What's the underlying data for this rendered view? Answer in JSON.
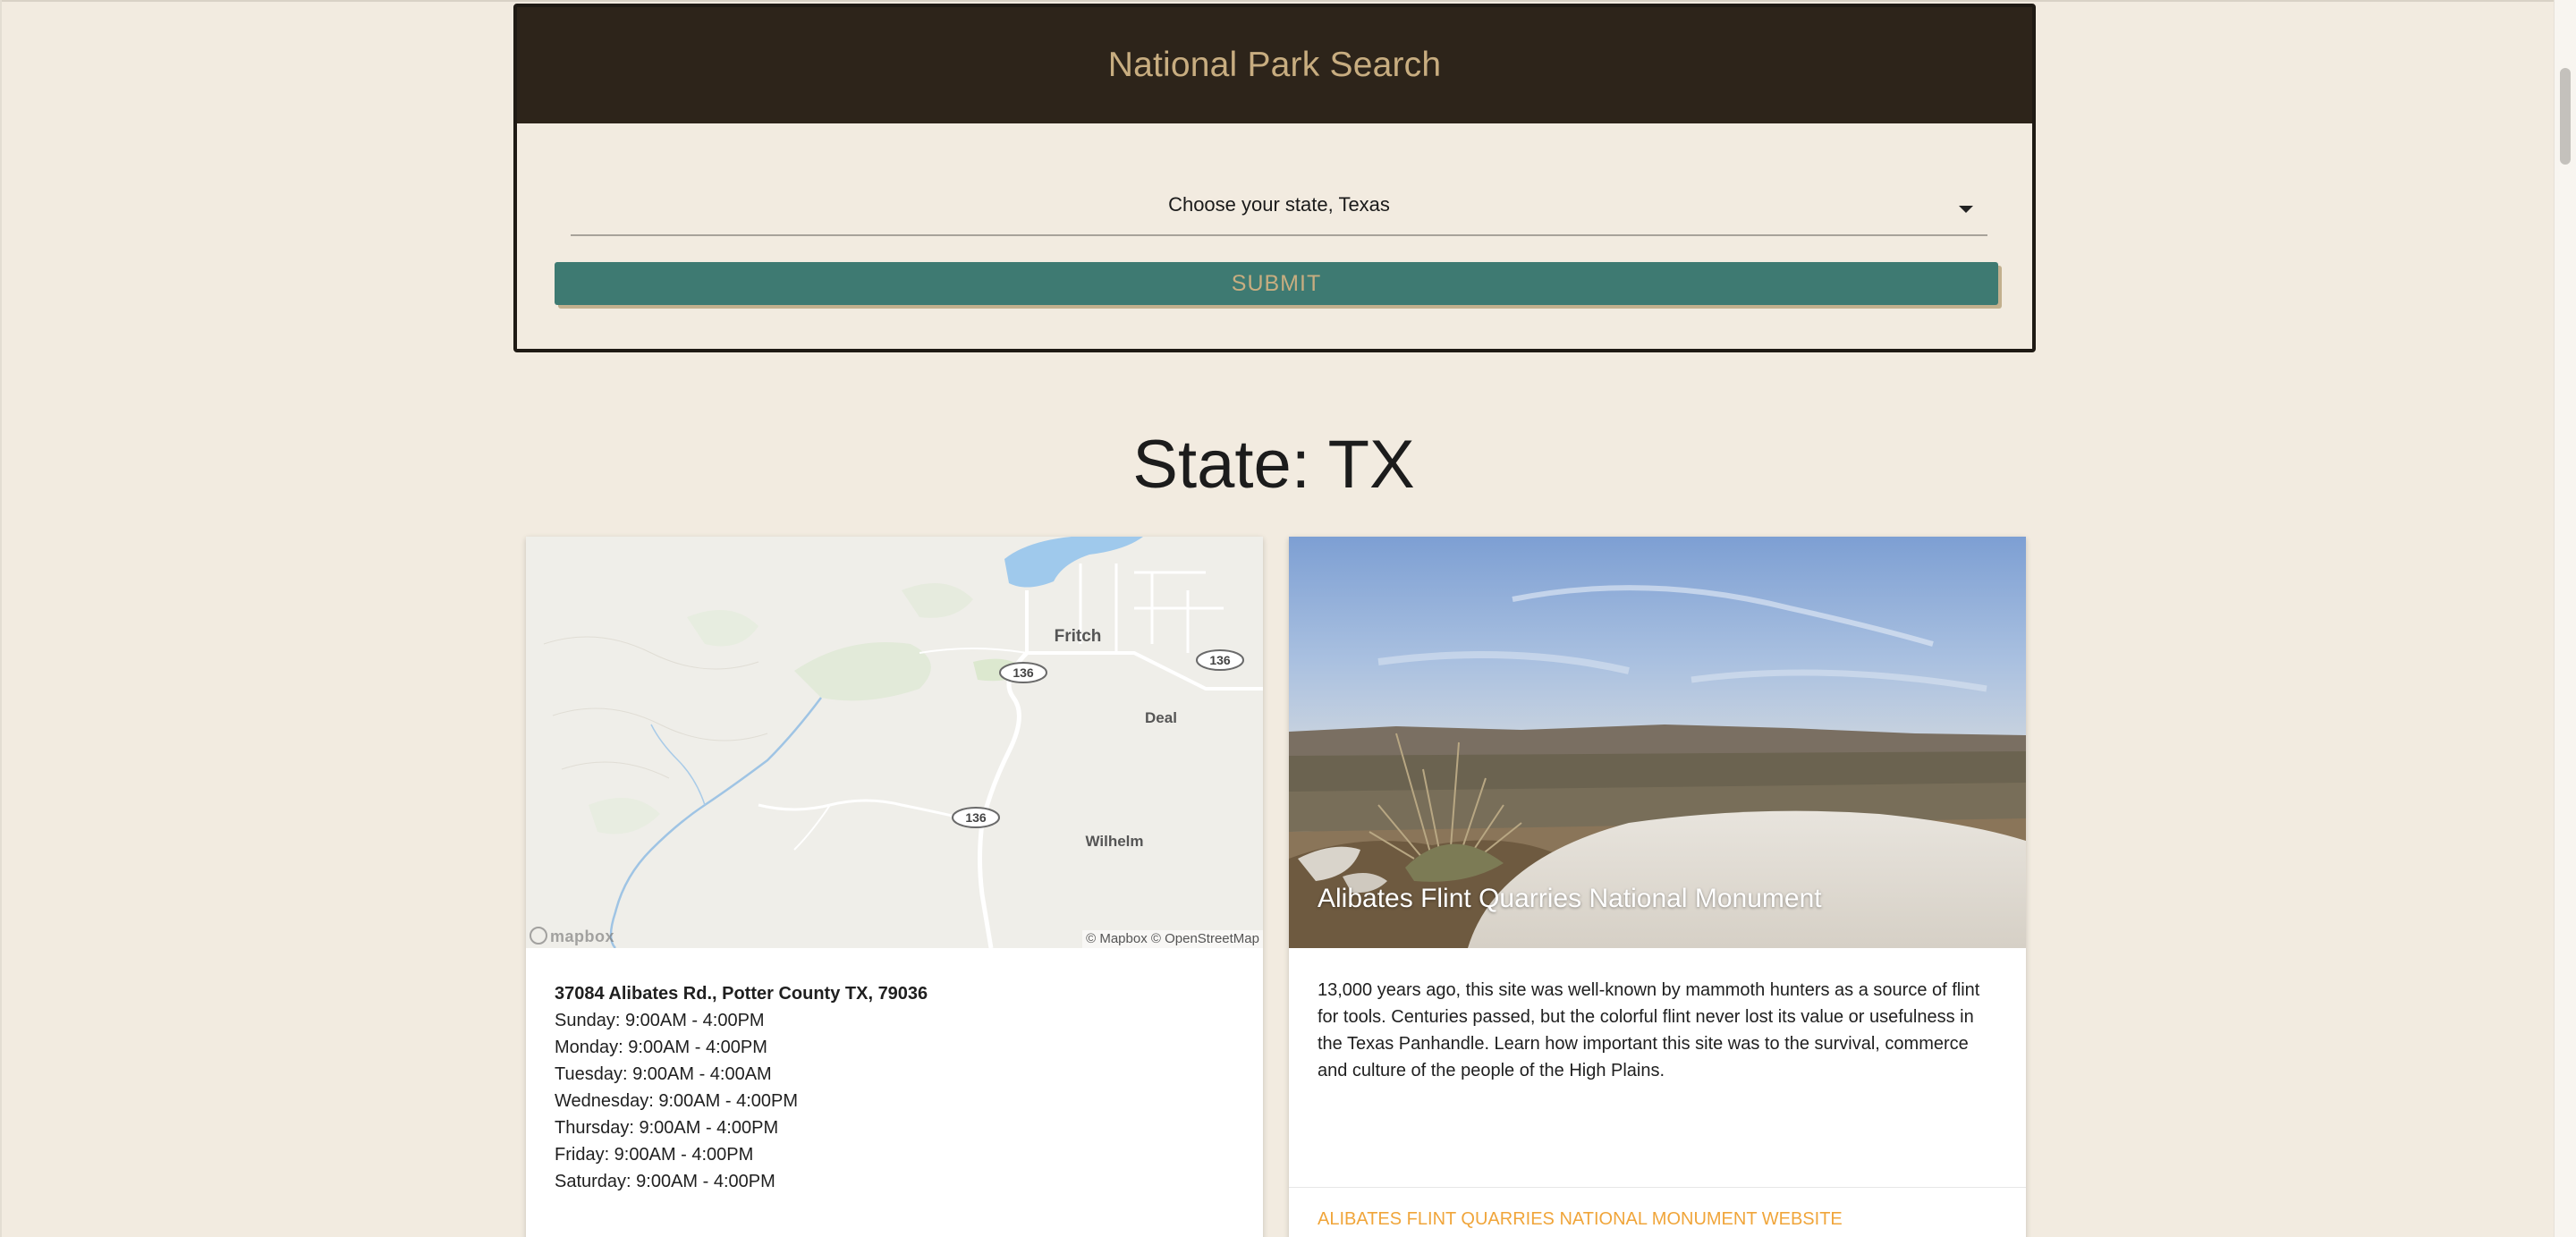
{
  "search": {
    "title": "National Park Search",
    "select_value": "Choose your state, Texas",
    "submit_label": "SUBMIT"
  },
  "state_heading": "State: TX",
  "park": {
    "name": "Alibates Flint Quarries National Monument",
    "address": "37084 Alibates Rd., Potter County TX, 79036",
    "hours": [
      "Sunday: 9:00AM - 4:00PM",
      "Monday: 9:00AM - 4:00PM",
      "Tuesday: 9:00AM - 4:00AM",
      "Wednesday: 9:00AM - 4:00PM",
      "Thursday: 9:00AM - 4:00PM",
      "Friday: 9:00AM - 4:00PM",
      "Saturday: 9:00AM - 4:00PM"
    ],
    "description": "13,000 years ago, this site was well-known by mammoth hunters as a source of flint for tools. Centuries passed, but the colorful flint never lost its value or usefulness in the Texas Panhandle. Learn how important this site was to the survival, commerce and culture of the people of the High Plains.",
    "website_label": "ALIBATES FLINT QUARRIES NATIONAL MONUMENT WEBSITE"
  },
  "map": {
    "labels": {
      "fritch": "Fritch",
      "deal": "Deal",
      "wilhelm": "Wilhelm"
    },
    "route_label": "136",
    "credit": "© Mapbox © OpenStreetMap",
    "logo_text": "mapbox"
  },
  "colors": {
    "page_bg": "#f2ebe0",
    "header_bg": "#2d241a",
    "header_text": "#c8ad80",
    "submit_bg": "#3e7a72",
    "link": "#f0a53a"
  },
  "icons": {
    "select_caret": "caret-down-icon",
    "mapbox_logo": "mapbox-logo-icon"
  }
}
